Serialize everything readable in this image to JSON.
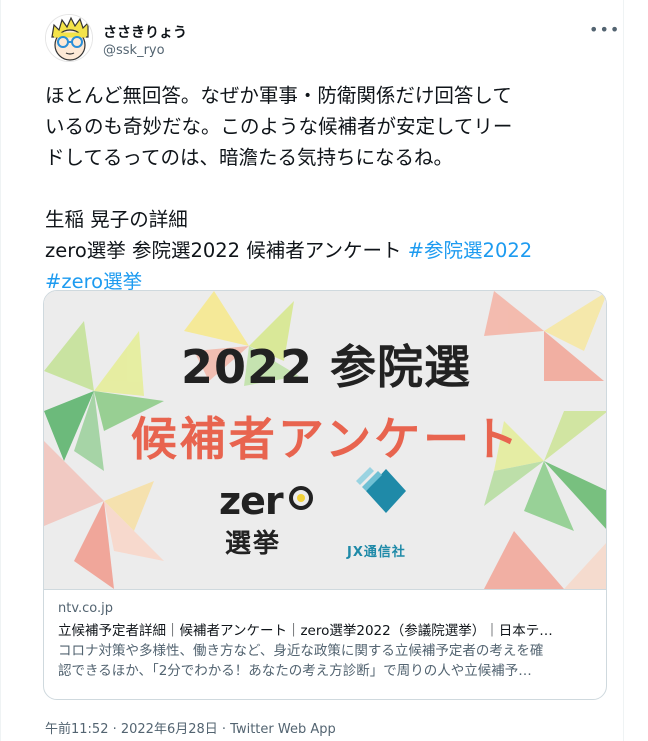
{
  "user": {
    "display_name": "ささきりょう",
    "handle": "@ssk_ryo"
  },
  "menu_icon": "more-horizontal-icon",
  "tweet": {
    "lines": [
      "ほとんど無回答。なぜか軍事・防衛関係だけ回答して",
      "いるのも奇妙だな。このような候補者が安定してリー",
      "ドしてるってのは、暗澹たる気持ちになるね。"
    ],
    "link_line1": "生稲 晃子の詳細",
    "link_line2_text": "zero選挙 参院選2022 候補者アンケート ",
    "hashtag1": "#参院選2022",
    "hashtag2": "#zero選挙"
  },
  "card": {
    "image": {
      "headline": "2022 参院選",
      "subheadline": "候補者アンケート",
      "logo_zero": "zer",
      "logo_zero_sub": "選挙",
      "logo_jx": "JX通信社",
      "accent_color": "#e8644f",
      "jx_color": "#1f8aa8"
    },
    "domain": "ntv.co.jp",
    "title": "立候補予定者詳細｜候補者アンケート｜zero選挙2022（参議院選挙）｜日本テ…",
    "description_line1": "コロナ対策や多様性、働き方など、身近な政策に関する立候補予定者の考えを確",
    "description_line2": "認できるほか、「2分でわかる！あなたの考え方診断」で周りの人や立候補予…"
  },
  "timestamp": "午前11:52 · 2022年6月28日 · Twitter Web App",
  "colors": {
    "link": "#1d9bf0",
    "text": "#0f1419",
    "muted": "#536471",
    "border": "#cfd9de"
  }
}
